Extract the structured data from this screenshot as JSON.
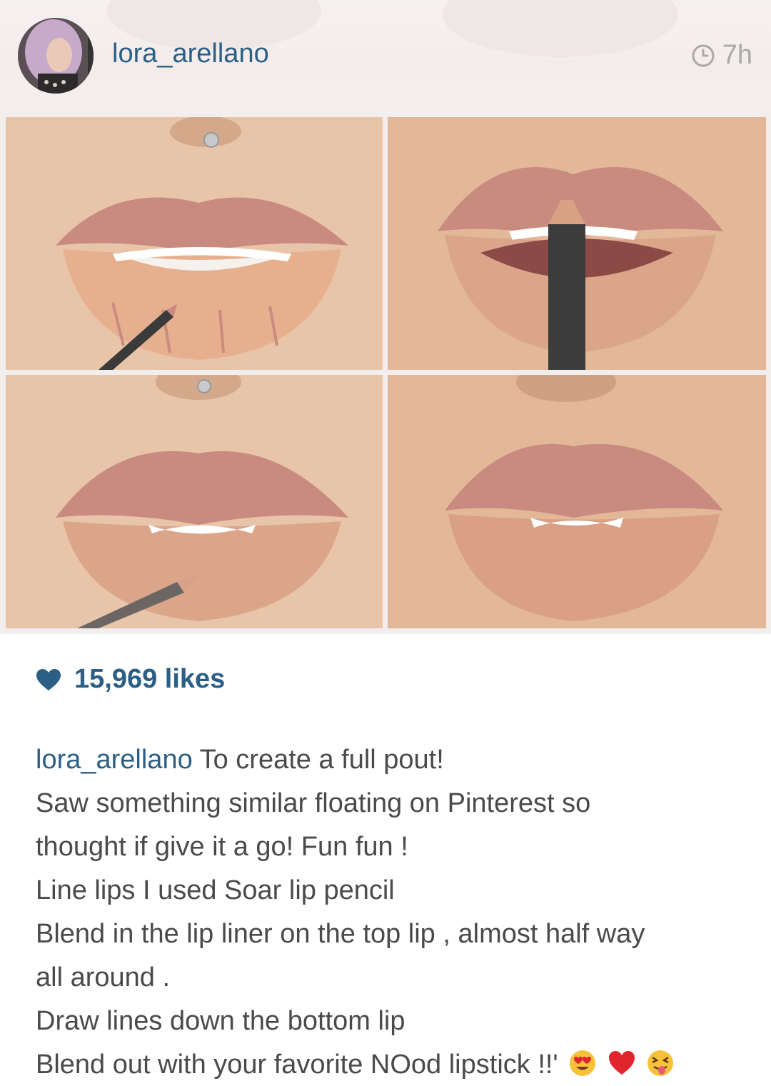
{
  "post": {
    "username": "lora_arellano",
    "time_ago": "7h",
    "likes": "15,969 likes",
    "caption": {
      "author": "lora_arellano",
      "first_line": "To create a full pout!",
      "lines": [
        "Saw something similar floating on Pinterest so",
        "thought if give it a go! Fun fun !",
        "Line lips I used Soar lip pencil",
        "Blend in the lip liner on the top lip , almost half way",
        "all around .",
        "Draw lines down the bottom lip",
        "Blend out with your favorite NOod lipstick !!'"
      ],
      "emojis": [
        "heart-eyes-face",
        "red-heart",
        "squinting-tongue-face"
      ]
    }
  },
  "colors": {
    "username": "#2b5f86",
    "timestamp": "#a9a9a9",
    "caption_text": "#4a4a4a",
    "lip": "#c98a80",
    "skin": "#e7c4a6"
  },
  "icons": {
    "time": "clock-icon",
    "likes": "heart-icon"
  }
}
